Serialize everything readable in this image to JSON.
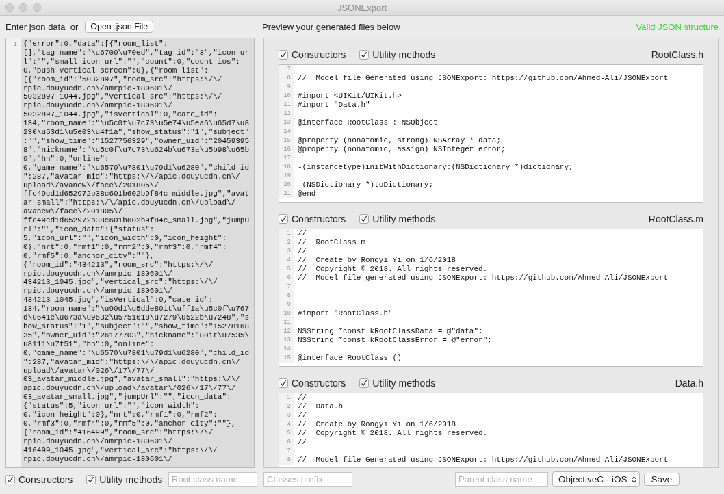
{
  "window": {
    "title": "JSONExport"
  },
  "header": {
    "prompt": "Enter json data  or",
    "open_button": "Open .json File",
    "preview_label": "Preview your generated files below",
    "status": "Valid JSON structure"
  },
  "json_editor": {
    "line_number": "1",
    "lines": [
      "{\"error\":0,\"data\":[{\"room_list\":",
      "[],\"tag_name\":\"\\u6700\\u70ed\",\"tag_id\":\"3\",\"icon_ur",
      "l\":\"\",\"small_icon_url\":\"\",\"count\":0,\"count_ios\":",
      "0,\"push_vertical_screen\":0},{\"room_list\":",
      "[{\"room_id\":\"5032897\",\"room_src\":\"https:\\/\\/",
      "rpic.douyucdn.cn\\/amrpic-180601\\/",
      "5032897_1044.jpg\",\"vertical_src\":\"https:\\/\\/",
      "rpic.douyucdn.cn\\/amrpic-180601\\/",
      "5032897_1044.jpg\",\"isVertical\":0,\"cate_id\":",
      "134,\"room_name\":\"\\u5c0f\\u7c73\\u5e74\\u5ea6\\u65d7\\u8",
      "230\\u53d1\\u5e03\\u4f1a\",\"show_status\":\"1\",\"subject\"",
      ":\"\",\"show_time\":\"1527756329\",\"owner_uid\":\"20459395",
      "8\",\"nickname\":\"\\u5c0f\\u7c73\\u624b\\u673a\\u5b98\\u65b",
      "9\",\"hn\":0,\"online\":",
      "0,\"game_name\":\"\\u6570\\u7801\\u79d1\\u6280\",\"child_id",
      "\":287,\"avatar_mid\":\"https:\\/\\/apic.douyucdn.cn\\/",
      "upload\\/avanew\\/face\\/201805\\/",
      "ffc49cd1d652972b38c601b602b9f84c_middle.jpg\",\"avat",
      "ar_small\":\"https:\\/\\/apic.douyucdn.cn\\/upload\\/",
      "avanew\\/face\\/201805\\/",
      "ffc49cd1d652972b38c601b602b9f84c_small.jpg\",\"jumpU",
      "rl\":\"\",\"icon_data\":{\"status\":",
      "5,\"icon_url\":\"\",\"icon_width\":0,\"icon_height\":",
      "0},\"nrt\":0,\"rmf1\":0,\"rmf2\":0,\"rmf3\":0,\"rmf4\":",
      "0,\"rmf5\":0,\"anchor_city\":\"\"},",
      "{\"room_id\":\"434213\",\"room_src\":\"https:\\/\\/",
      "rpic.douyucdn.cn\\/amrpic-180601\\/",
      "434213_1045.jpg\",\"vertical_src\":\"https:\\/\\/",
      "rpic.douyucdn.cn\\/amrpic-180601\\/",
      "434213_1045.jpg\",\"isVertical\":0,\"cate_id\":",
      "134,\"room_name\":\"\\u90d1\\u5dde80it\\uff1a\\u5c0f\\u767",
      "d\\u641e\\u673a\\u9632\\u5751618\\u7279\\u522b\\u7248\",\"s",
      "how_status\":\"1\",\"subject\":\"\",\"show_time\":\"15278168",
      "35\",\"owner_uid\":\"26177703\",\"nickname\":\"80it\\u7535\\",
      "u8111\\u7f51\",\"hn\":0,\"online\":",
      "0,\"game_name\":\"\\u6570\\u7801\\u79d1\\u6280\",\"child_id",
      "\":287,\"avatar_mid\":\"https:\\/\\/apic.douyucdn.cn\\/",
      "upload\\/avatar\\/026\\/17\\/77\\/",
      "03_avatar_middle.jpg\",\"avatar_small\":\"https:\\/\\/",
      "apic.douyucdn.cn\\/upload\\/avatar\\/026\\/17\\/77\\/",
      "03_avatar_small.jpg\",\"jumpUrl\":\"\",\"icon_data\":",
      "{\"status\":5,\"icon_url\":\"\",\"icon_width\":",
      "0,\"icon_height\":0},\"nrt\":0,\"rmf1\":0,\"rmf2\":",
      "0,\"rmf3\":0,\"rmf4\":0,\"rmf5\":0,\"anchor_city\":\"\"},",
      "{\"room_id\":\"416499\",\"room_src\":\"https:\\/\\/",
      "rpic.douyucdn.cn\\/amrpic-180601\\/",
      "416499_1045.jpg\",\"vertical_src\":\"https:\\/\\/",
      "rpic.douyucdn.cn\\/amrpic-180601\\/"
    ]
  },
  "files": [
    {
      "constructors": {
        "label": "Constructors",
        "checked": true
      },
      "utility": {
        "label": "Utility methods",
        "checked": true
      },
      "filename": "RootClass.h",
      "code": [
        {
          "number": "7"
        },
        {
          "number": "8",
          "text": "//  Model file Generated using JSONExport: https://github.com/Ahmed-Ali/JSONExport"
        },
        {
          "number": "9"
        },
        {
          "number": "10",
          "text": "#import <UIKit/UIKit.h>"
        },
        {
          "number": "11",
          "text": "#import \"Data.h\""
        },
        {
          "number": "12"
        },
        {
          "number": "13",
          "text": "@interface RootClass : NSObject"
        },
        {
          "number": "14"
        },
        {
          "number": "15",
          "text": "@property (nonatomic, strong) NSArray * data;"
        },
        {
          "number": "16",
          "text": "@property (nonatomic, assign) NSInteger error;"
        },
        {
          "number": "17"
        },
        {
          "number": "18",
          "text": "-(instancetype)initWithDictionary:(NSDictionary *)dictionary;"
        },
        {
          "number": "19"
        },
        {
          "number": "20",
          "text": "-(NSDictionary *)toDictionary;"
        },
        {
          "number": "21",
          "text": "@end"
        }
      ]
    },
    {
      "constructors": {
        "label": "Constructors",
        "checked": true
      },
      "utility": {
        "label": "Utility methods",
        "checked": true
      },
      "filename": "RootClass.m",
      "code": [
        {
          "number": "1",
          "text": "//"
        },
        {
          "number": "2",
          "text": "//  RootClass.m"
        },
        {
          "number": "3",
          "text": "//"
        },
        {
          "number": "4",
          "text": "//  Create by Rongyi Yi on 1/6/2018"
        },
        {
          "number": "5",
          "text": "//  Copyright © 2018. All rights reserved."
        },
        {
          "number": "6",
          "text": "//  Model file generated using JSONExport: https://github.com/Ahmed-Ali/JSONExport"
        },
        {
          "number": "7"
        },
        {
          "number": "8"
        },
        {
          "number": "9"
        },
        {
          "number": "10",
          "text": "#import \"RootClass.h\""
        },
        {
          "number": "11"
        },
        {
          "number": "12",
          "text": "NSString *const kRootClassData = @\"data\";"
        },
        {
          "number": "13",
          "text": "NSString *const kRootClassError = @\"error\";"
        },
        {
          "number": "14"
        },
        {
          "number": "15",
          "text": "@interface RootClass ()"
        }
      ]
    },
    {
      "constructors": {
        "label": "Constructors",
        "checked": true
      },
      "utility": {
        "label": "Utility methods",
        "checked": true
      },
      "filename": "Data.h",
      "code": [
        {
          "number": "1",
          "text": "//"
        },
        {
          "number": "2",
          "text": "//  Data.h"
        },
        {
          "number": "3",
          "text": "//"
        },
        {
          "number": "4",
          "text": "//  Create by Rongyi Yi on 1/6/2018"
        },
        {
          "number": "5",
          "text": "//  Copyright © 2018. All rights reserved."
        },
        {
          "number": "6",
          "text": "//"
        },
        {
          "number": "7"
        },
        {
          "number": "8",
          "text": "//  Model file Generated using JSONExport: https://github.com/Ahmed-Ali/JSONExport"
        }
      ]
    }
  ],
  "bottom_bar": {
    "constructors": {
      "label": "Constructors",
      "checked": true
    },
    "utility": {
      "label": "Utility methods",
      "checked": true
    },
    "root_class": {
      "placeholder": "Root class name"
    },
    "classes_prefix": {
      "placeholder": "Classes prefix"
    },
    "parent_class": {
      "placeholder": "Parent class name"
    },
    "language": "ObjectiveC - iOS",
    "save_button": "Save"
  }
}
